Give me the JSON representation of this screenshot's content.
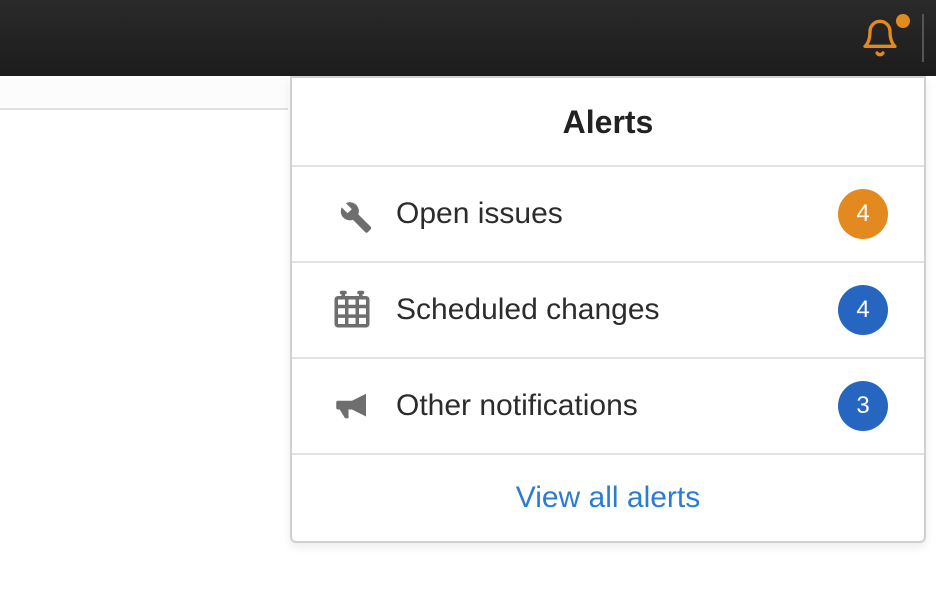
{
  "header": {
    "title": "Alerts"
  },
  "alerts": {
    "items": [
      {
        "label": "Open issues",
        "count": "4",
        "badge_color": "orange"
      },
      {
        "label": "Scheduled changes",
        "count": "4",
        "badge_color": "blue"
      },
      {
        "label": "Other notifications",
        "count": "3",
        "badge_color": "blue"
      }
    ]
  },
  "footer": {
    "view_all_label": "View all alerts"
  },
  "colors": {
    "accent_orange": "#e28a1f",
    "accent_blue": "#2666c1",
    "link_blue": "#2b7cd3"
  }
}
